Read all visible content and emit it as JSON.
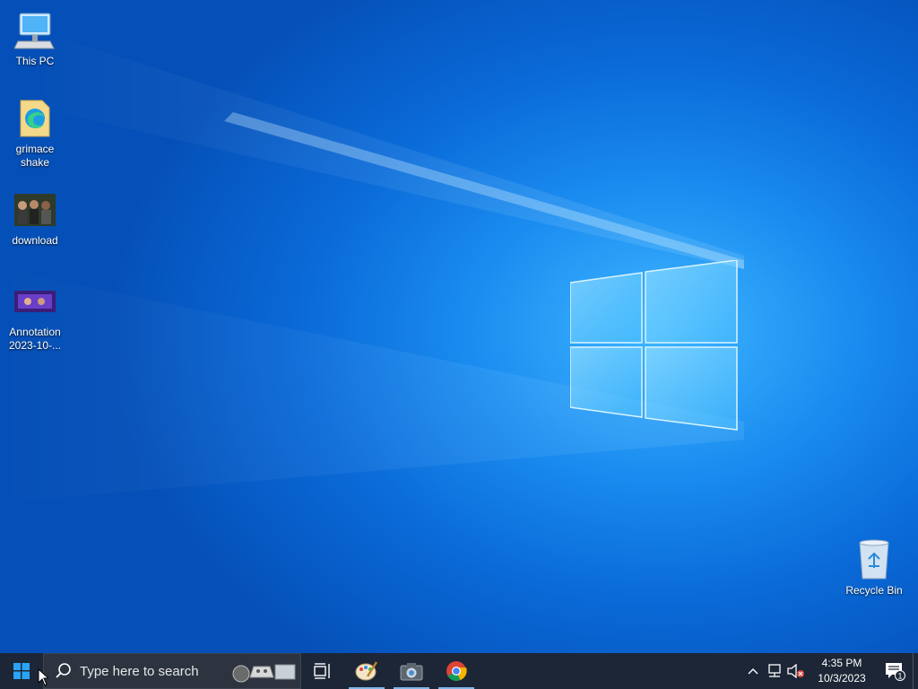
{
  "desktop": {
    "icons": [
      {
        "label_line1": "This PC",
        "label_line2": ""
      },
      {
        "label_line1": "grimace",
        "label_line2": "shake"
      },
      {
        "label_line1": "download",
        "label_line2": ""
      },
      {
        "label_line1": "Annotation",
        "label_line2": "2023-10-..."
      },
      {
        "label_line1": "Recycle Bin",
        "label_line2": ""
      }
    ]
  },
  "taskbar": {
    "search_placeholder": "Type here to search",
    "apps": [
      {
        "name": "Task View",
        "icon": "task-view-icon",
        "active": false
      },
      {
        "name": "Paint",
        "icon": "paint-icon",
        "active": true
      },
      {
        "name": "Camera",
        "icon": "camera-icon",
        "active": true
      },
      {
        "name": "Google Chrome",
        "icon": "chrome-icon",
        "active": true
      }
    ],
    "tray": {
      "time": "4:35 PM",
      "date": "10/3/2023",
      "notification_count": "1"
    }
  },
  "colors": {
    "taskbar_bg": "#1c2636",
    "search_bg": "#2d3440",
    "desktop_accent": "#1a8cf0"
  }
}
